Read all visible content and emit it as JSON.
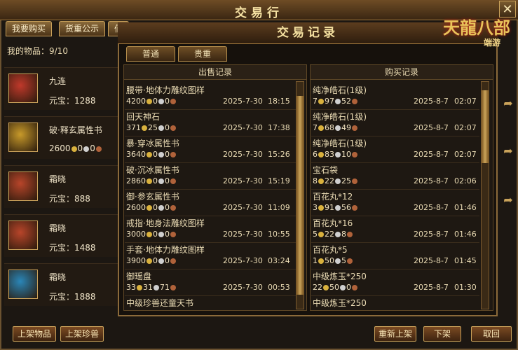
{
  "window": {
    "title": "交易行",
    "close_icon": "✕"
  },
  "top_tabs": [
    "我要购买",
    "货重公示",
    "佰"
  ],
  "items_label": "我的物品：9/10",
  "items": [
    {
      "name": "九连",
      "price": "元宝：1288",
      "icon": "red-jade-pendant-icon",
      "color": "#c0392b"
    },
    {
      "name": "破·释玄属性书",
      "price": "2600",
      "price_coins": [
        "0",
        "0"
      ],
      "icon": "golden-book-icon",
      "color": "#c89a2a"
    },
    {
      "name": "霜晓",
      "price": "元宝：888",
      "icon": "red-bracelet-icon",
      "color": "#b8452a"
    },
    {
      "name": "霜晓",
      "price": "元宝：1488",
      "icon": "red-bracelet-icon",
      "color": "#b8452a"
    },
    {
      "name": "霜晓",
      "price": "元宝：1888",
      "icon": "blue-bracelet-icon",
      "color": "#2a86b8"
    }
  ],
  "bottom_buttons": {
    "list_item": "上架物品",
    "list_pet": "上架珍兽",
    "relist": "重新上架",
    "delist": "下架",
    "withdraw": "取回"
  },
  "modal": {
    "title": "交易记录",
    "tabs": [
      "普通",
      "贵重"
    ]
  },
  "sales": {
    "header": "出售记录",
    "records": [
      {
        "name": "腰带·地体力雕纹图样",
        "p": [
          "4200",
          "0",
          "0"
        ],
        "date": "2025-7-30",
        "time": "18:15"
      },
      {
        "name": "回天神石",
        "p": [
          "371",
          "25",
          "0"
        ],
        "date": "2025-7-30",
        "time": "17:38"
      },
      {
        "name": "暴·穿冰属性书",
        "p": [
          "3640",
          "0",
          "0"
        ],
        "date": "2025-7-30",
        "time": "15:26"
      },
      {
        "name": "破·沉冰属性书",
        "p": [
          "2860",
          "0",
          "0"
        ],
        "date": "2025-7-30",
        "time": "15:19"
      },
      {
        "name": "御·参玄属性书",
        "p": [
          "2600",
          "0",
          "0"
        ],
        "date": "2025-7-30",
        "time": "11:09"
      },
      {
        "name": "戒指·地身法雕纹图样",
        "p": [
          "3000",
          "0",
          "0"
        ],
        "date": "2025-7-30",
        "time": "10:55"
      },
      {
        "name": "手套·地体力雕纹图样",
        "p": [
          "3900",
          "0",
          "0"
        ],
        "date": "2025-7-30",
        "time": "03:24"
      },
      {
        "name": "御瑶盘",
        "p": [
          "33",
          "31",
          "71"
        ],
        "date": "2025-7-30",
        "time": "00:53"
      },
      {
        "name": "中级珍兽还童天书",
        "p": [
          "",
          "",
          ""
        ],
        "date": "",
        "time": ""
      }
    ]
  },
  "purchases": {
    "header": "购买记录",
    "records": [
      {
        "name": "纯净皓石(1级)",
        "p": [
          "7",
          "97",
          "52"
        ],
        "date": "2025-8-7",
        "time": "02:07"
      },
      {
        "name": "纯净皓石(1级)",
        "p": [
          "7",
          "68",
          "49"
        ],
        "date": "2025-8-7",
        "time": "02:07"
      },
      {
        "name": "纯净皓石(1级)",
        "p": [
          "6",
          "83",
          "10"
        ],
        "date": "2025-8-7",
        "time": "02:07"
      },
      {
        "name": "宝石袋",
        "p": [
          "8",
          "22",
          "25"
        ],
        "date": "2025-8-7",
        "time": "02:06"
      },
      {
        "name": "百花丸*12",
        "p": [
          "3",
          "91",
          "56"
        ],
        "date": "2025-8-7",
        "time": "01:46"
      },
      {
        "name": "百花丸*16",
        "p": [
          "5",
          "22",
          "8"
        ],
        "date": "2025-8-7",
        "time": "01:46"
      },
      {
        "name": "百花丸*5",
        "p": [
          "1",
          "50",
          "5"
        ],
        "date": "2025-8-7",
        "time": "01:45"
      },
      {
        "name": "中级炼玉*250",
        "p": [
          "22",
          "50",
          "0"
        ],
        "date": "2025-8-7",
        "time": "01:30"
      },
      {
        "name": "中级炼玉*250",
        "p": [
          "",
          "",
          ""
        ],
        "date": "",
        "time": ""
      }
    ]
  },
  "logo": {
    "text": "天龍八部",
    "sub": "端游"
  },
  "colors": {
    "gold": "#d9b13d",
    "silver": "#cfcfcf",
    "copper": "#b0623a",
    "accent": "#c9a15a"
  }
}
